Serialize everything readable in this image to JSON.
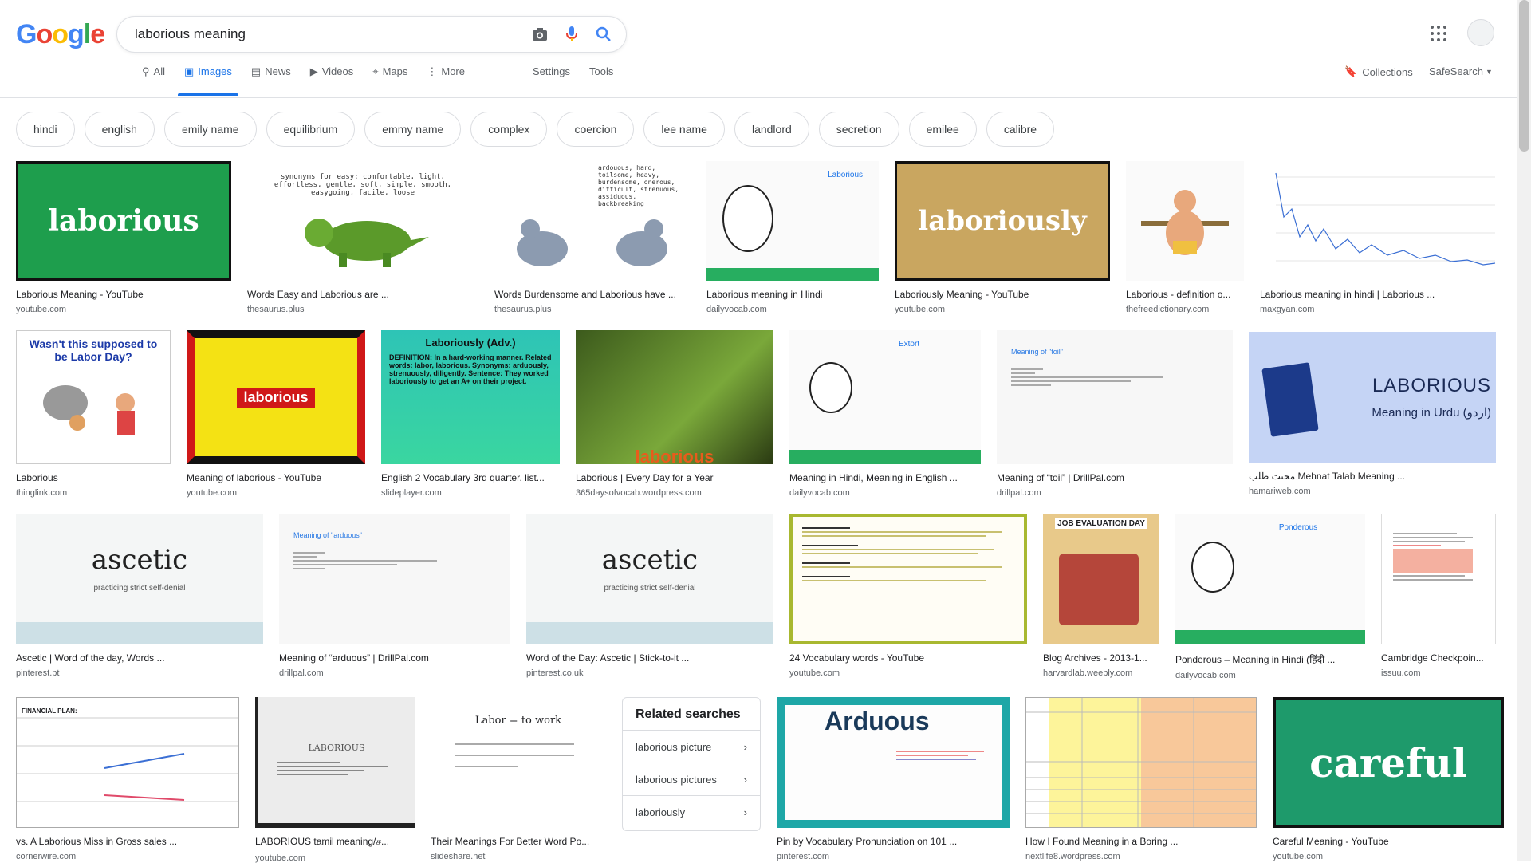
{
  "app": {
    "logo": "Google"
  },
  "search": {
    "query": "laborious meaning",
    "placeholder": ""
  },
  "tabs": [
    {
      "label": "All",
      "icon": "search-icon"
    },
    {
      "label": "Images",
      "icon": "image-icon",
      "active": true
    },
    {
      "label": "News",
      "icon": "news-icon"
    },
    {
      "label": "Videos",
      "icon": "video-icon"
    },
    {
      "label": "Maps",
      "icon": "map-icon"
    },
    {
      "label": "More",
      "icon": "more-icon"
    }
  ],
  "tools": {
    "settings": "Settings",
    "tools": "Tools"
  },
  "right_nav": {
    "collections": "Collections",
    "safesearch": "SafeSearch"
  },
  "chips": [
    "hindi",
    "english",
    "emily name",
    "equilibrium",
    "emmy name",
    "complex",
    "coercion",
    "lee name",
    "landlord",
    "secretion",
    "emilee",
    "calibre"
  ],
  "results": {
    "row1": [
      {
        "caption": "Laborious Meaning - YouTube",
        "source": "youtube.com",
        "text": "laborious"
      },
      {
        "caption": "Words Easy and Laborious are ...",
        "source": "thesaurus.plus",
        "text": "synonyms for easy: comfortable, light, effortless, gentle, soft, simple, smooth, easygoing, facile, loose"
      },
      {
        "caption": "Words Burdensome and Laborious have ...",
        "source": "thesaurus.plus",
        "text": "ardouous, hard, toilsome, heavy, burdensome, onerous, difficult, strenuous, assiduous, backbreaking"
      },
      {
        "caption": "Laborious meaning in Hindi",
        "source": "dailyvocab.com",
        "text": "Laborious"
      },
      {
        "caption": "Laboriously Meaning - YouTube",
        "source": "youtube.com",
        "text": "laboriously"
      },
      {
        "caption": "Laborious - definition o...",
        "source": "thefreedictionary.com",
        "text": ""
      },
      {
        "caption": "Laborious meaning in hindi | Laborious ...",
        "source": "maxgyan.com",
        "text": ""
      }
    ],
    "row2": [
      {
        "caption": "Laborious",
        "source": "thinglink.com",
        "text": "Wasn't this supposed to be Labor Day?"
      },
      {
        "caption": "Meaning of laborious - YouTube",
        "source": "youtube.com",
        "text": "laborious"
      },
      {
        "caption": "English 2 Vocabulary 3rd quarter. list...",
        "source": "slideplayer.com",
        "text": "Laboriously (Adv.)",
        "body": "DEFINITION: In a hard-working manner. Related words: labor, laborious. Synonyms: arduously, strenuously, diligently. Sentence: They worked laboriously to get an A+ on their project."
      },
      {
        "caption": "Laborious | Every Day for a Year",
        "source": "365daysofvocab.wordpress.com",
        "text": "laborious"
      },
      {
        "caption": "Meaning in Hindi, Meaning in English ...",
        "source": "dailyvocab.com",
        "text": "Extort"
      },
      {
        "caption": "Meaning of “toil” | DrillPal.com",
        "source": "drillpal.com",
        "text": "Meaning of \"toil\""
      },
      {
        "caption": "محنت طلب Mehnat Talab Meaning ...",
        "source": "hamariweb.com",
        "text": "LABORIOUS",
        "sub": "Meaning in Urdu (اردو)"
      }
    ],
    "row3": [
      {
        "caption": "Ascetic | Word of the day, Words ...",
        "source": "pinterest.pt",
        "text": "ascetic",
        "sub": "practicing strict self-denial"
      },
      {
        "caption": "Meaning of “arduous” | DrillPal.com",
        "source": "drillpal.com",
        "text": "Meaning of \"arduous\""
      },
      {
        "caption": "Word of the Day: Ascetic | Stick-to-it ...",
        "source": "pinterest.co.uk",
        "text": "ascetic",
        "sub": "practicing strict self-denial"
      },
      {
        "caption": "24 Vocabulary words - YouTube",
        "source": "youtube.com",
        "text": ""
      },
      {
        "caption": "Blog Archives - 2013-1...",
        "source": "harvardlab.weebly.com",
        "text": "JOB EVALUATION DAY"
      },
      {
        "caption": "Ponderous – Meaning in Hindi (हिंदी ...",
        "source": "dailyvocab.com",
        "text": "Ponderous"
      },
      {
        "caption": "Cambridge Checkpoin...",
        "source": "issuu.com",
        "text": ""
      }
    ],
    "row4": [
      {
        "caption": "vs. A Laborious Miss in Gross sales ...",
        "source": "cornerwire.com",
        "text": "FINANCIAL PLAN:"
      },
      {
        "caption": "LABORIOUS tamil meaning/ச...",
        "source": "youtube.com",
        "text": "LABORIOUS"
      },
      {
        "caption": "Their Meanings For Better Word Po...",
        "source": "slideshare.net",
        "text": "Labor = to work"
      },
      {
        "caption": "Pin by Vocabulary Pronunciation on 101 ...",
        "source": "pinterest.com",
        "text": "Arduous"
      },
      {
        "caption": "How I Found Meaning in a Boring ...",
        "source": "nextlife8.wordpress.com",
        "text": ""
      },
      {
        "caption": "Careful Meaning - YouTube",
        "source": "youtube.com",
        "text": "careful"
      }
    ]
  },
  "related": {
    "title": "Related searches",
    "items": [
      "laborious picture",
      "laborious pictures",
      "laboriously"
    ]
  },
  "colors": {
    "accent": "#1a73e8",
    "green": "#1fa04b",
    "tan": "#c9a660"
  }
}
